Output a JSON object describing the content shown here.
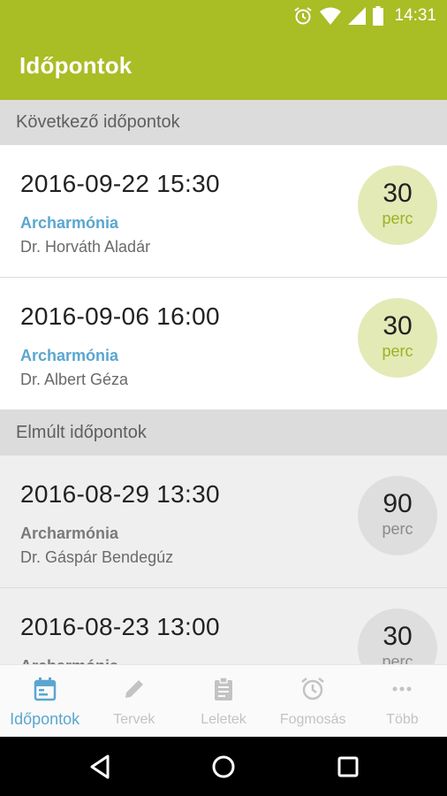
{
  "status_bar": {
    "time": "14:31",
    "icons": [
      "alarm-icon",
      "wifi-icon",
      "signal-icon",
      "battery-icon"
    ]
  },
  "app_bar": {
    "title": "Időpontok"
  },
  "colors": {
    "primary": "#a9bd25",
    "accent_blue": "#5aa6d0",
    "upcoming_badge": "#e3eab6",
    "past_badge": "#dedede"
  },
  "sections": {
    "upcoming": {
      "title": "Következő időpontok",
      "items": [
        {
          "datetime": "2016-09-22 15:30",
          "clinic": "Archarmónia",
          "doctor": "Dr. Horváth Aladár",
          "duration": "30",
          "unit": "perc"
        },
        {
          "datetime": "2016-09-06 16:00",
          "clinic": "Archarmónia",
          "doctor": "Dr. Albert Géza",
          "duration": "30",
          "unit": "perc"
        }
      ]
    },
    "past": {
      "title": "Elmúlt időpontok",
      "items": [
        {
          "datetime": "2016-08-29 13:30",
          "clinic": "Archarmónia",
          "doctor": "Dr. Gáspár Bendegúz",
          "duration": "90",
          "unit": "perc"
        },
        {
          "datetime": "2016-08-23 13:00",
          "clinic": "Archarmónia",
          "doctor": "",
          "duration": "30",
          "unit": "perc"
        }
      ]
    }
  },
  "bottom_nav": {
    "items": [
      {
        "label": "Időpontok",
        "icon": "calendar-icon",
        "active": true
      },
      {
        "label": "Tervek",
        "icon": "pencil-icon",
        "active": false
      },
      {
        "label": "Leletek",
        "icon": "clipboard-icon",
        "active": false
      },
      {
        "label": "Fogmosás",
        "icon": "alarm-clock-icon",
        "active": false
      },
      {
        "label": "Több",
        "icon": "more-icon",
        "active": false
      }
    ]
  },
  "system_nav": {
    "buttons": [
      "back-icon",
      "home-icon",
      "recents-icon"
    ]
  }
}
